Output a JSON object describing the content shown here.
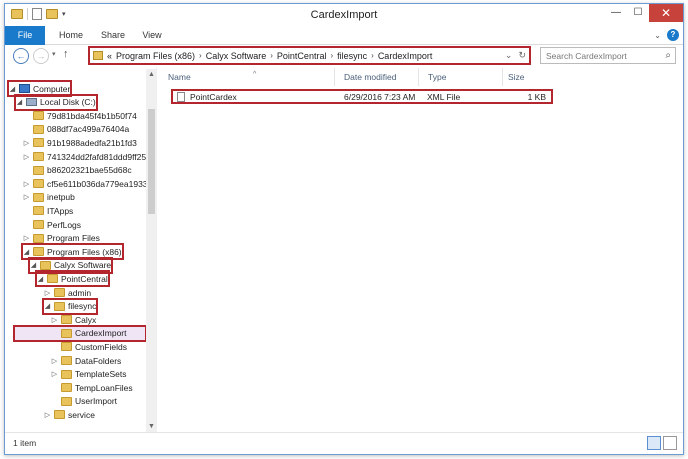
{
  "window": {
    "title": "CardexImport"
  },
  "ribbon": {
    "tabs": [
      "File",
      "Home",
      "Share",
      "View"
    ]
  },
  "address": {
    "prefix": "«",
    "segments": [
      "Program Files (x86)",
      "Calyx Software",
      "PointCentral",
      "filesync",
      "CardexImport"
    ]
  },
  "search": {
    "placeholder": "Search CardexImport"
  },
  "tree": [
    {
      "label": "Computer",
      "icon": "computer-icon",
      "depth": 0,
      "expander": "open",
      "highlight": true
    },
    {
      "label": "Local Disk (C:)",
      "icon": "disk-icon",
      "depth": 1,
      "expander": "open",
      "highlight": true
    },
    {
      "label": "79d81bda45f4b1b50f74",
      "icon": "folder-icon",
      "depth": 2,
      "expander": "none"
    },
    {
      "label": "088df7ac499a76404a",
      "icon": "folder-icon",
      "depth": 2,
      "expander": "none"
    },
    {
      "label": "91b1988adedfa21b1fd3",
      "icon": "folder-icon",
      "depth": 2,
      "expander": "closed"
    },
    {
      "label": "741324dd2fafd81ddd9ff25",
      "icon": "folder-icon",
      "depth": 2,
      "expander": "closed"
    },
    {
      "label": "b86202321bae55d68c",
      "icon": "folder-icon",
      "depth": 2,
      "expander": "none"
    },
    {
      "label": "cf5e611b036da779ea1933€",
      "icon": "folder-icon",
      "depth": 2,
      "expander": "closed"
    },
    {
      "label": "inetpub",
      "icon": "folder-icon",
      "depth": 2,
      "expander": "closed"
    },
    {
      "label": "ITApps",
      "icon": "folder-icon",
      "depth": 2,
      "expander": "none"
    },
    {
      "label": "PerfLogs",
      "icon": "folder-icon",
      "depth": 2,
      "expander": "none"
    },
    {
      "label": "Program Files",
      "icon": "folder-icon",
      "depth": 2,
      "expander": "closed"
    },
    {
      "label": "Program Files (x86)",
      "icon": "folder-icon",
      "depth": 2,
      "expander": "open",
      "highlight": true
    },
    {
      "label": "Calyx Software",
      "icon": "folder-icon",
      "depth": 3,
      "expander": "open",
      "highlight": true
    },
    {
      "label": "PointCentral",
      "icon": "folder-icon",
      "depth": 4,
      "expander": "open",
      "highlight": true
    },
    {
      "label": "admin",
      "icon": "folder-icon",
      "depth": 5,
      "expander": "closed"
    },
    {
      "label": "filesync",
      "icon": "folder-icon",
      "depth": 5,
      "expander": "open",
      "highlight": true
    },
    {
      "label": "Calyx",
      "icon": "folder-icon",
      "depth": 6,
      "expander": "closed"
    },
    {
      "label": "CardexImport",
      "icon": "folder-icon",
      "depth": 6,
      "expander": "none",
      "selected": true
    },
    {
      "label": "CustomFields",
      "icon": "folder-icon",
      "depth": 6,
      "expander": "none"
    },
    {
      "label": "DataFolders",
      "icon": "folder-icon",
      "depth": 6,
      "expander": "closed"
    },
    {
      "label": "TemplateSets",
      "icon": "folder-icon",
      "depth": 6,
      "expander": "closed"
    },
    {
      "label": "TempLoanFiles",
      "icon": "folder-icon",
      "depth": 6,
      "expander": "none"
    },
    {
      "label": "UserImport",
      "icon": "folder-icon",
      "depth": 6,
      "expander": "none"
    },
    {
      "label": "service",
      "icon": "folder-icon",
      "depth": 5,
      "expander": "closed"
    }
  ],
  "columns": [
    "Name",
    "Date modified",
    "Type",
    "Size"
  ],
  "files": [
    {
      "name": "PointCardex",
      "date": "6/29/2016 7:23 AM",
      "type": "XML File",
      "size": "1 KB"
    }
  ],
  "status": {
    "count": "1 item"
  },
  "colors": {
    "accent": "#1979ca",
    "highlight": "#b3262e",
    "folder": "#e8c25a"
  }
}
